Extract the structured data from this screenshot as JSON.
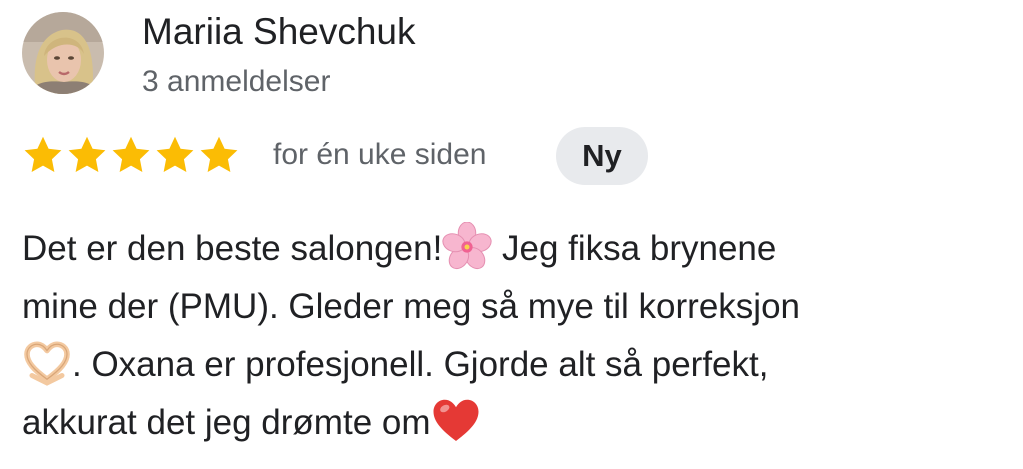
{
  "reviewer": {
    "name": "Mariia Shevchuk",
    "review_count": "3 anmeldelser",
    "avatar_icon": "reviewer-photo"
  },
  "rating": {
    "stars": 5,
    "max_stars": 5,
    "star_color": "#FBBC04",
    "time_ago": "for én uke siden",
    "badge": "Ny"
  },
  "review": {
    "line1_a": "Det er den beste salongen!",
    "line1_emoji": "cherry-blossom-icon",
    "line1_b": " Jeg fiksa brynene",
    "line2": "mine der (PMU). Gleder meg så mye til korreksjon",
    "line3_emoji": "heart-hands-icon",
    "line3": ". Oxana er profesjonell. Gjorde alt så perfekt,",
    "line4": "akkurat det jeg drømte om",
    "line4_emoji": "red-heart-icon"
  }
}
